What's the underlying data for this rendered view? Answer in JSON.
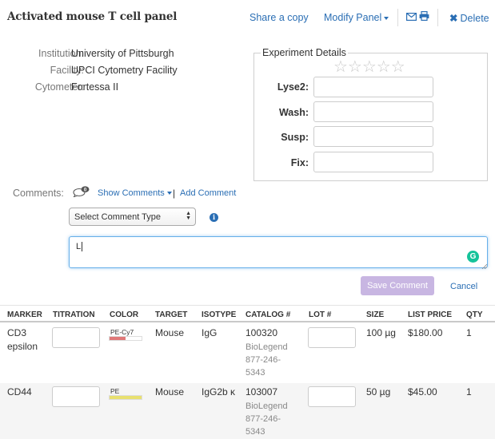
{
  "header": {
    "title": "Activated mouse T cell panel",
    "share_label": "Share a copy",
    "modify_label": "Modify Panel",
    "delete_label": "Delete"
  },
  "info": {
    "institution_label": "Institution:",
    "institution_value": "University of Pittsburgh",
    "facility_label": "Facility:",
    "facility_value": "UPCI Cytometry Facility",
    "cytometer_label": "Cytometer:",
    "cytometer_value": "Fortessa II"
  },
  "experiment": {
    "legend": "Experiment Details",
    "stars": "☆☆☆☆☆",
    "rating": 0,
    "rating_max": 5,
    "fields": [
      {
        "label": "Lyse2:",
        "value": ""
      },
      {
        "label": "Wash:",
        "value": ""
      },
      {
        "label": "Susp:",
        "value": ""
      },
      {
        "label": "Fix:",
        "value": ""
      }
    ]
  },
  "comments": {
    "label": "Comments:",
    "count": "0",
    "show_label": "Show Comments",
    "separator": "|",
    "add_label": "Add Comment",
    "type_select": "Select Comment Type",
    "text_value": "L",
    "save_label": "Save Comment",
    "cancel_label": "Cancel"
  },
  "table": {
    "columns": [
      "MARKER",
      "TITRATION",
      "COLOR",
      "TARGET",
      "ISOTYPE",
      "CATALOG #",
      "LOT #",
      "SIZE",
      "LIST PRICE",
      "QTY"
    ],
    "rows": [
      {
        "marker": "CD3 epsilon",
        "titration": "",
        "color": "PE-Cy7",
        "color_swatch": [
          "#e07878",
          "#e07878",
          "#ffffff",
          "#ffffff"
        ],
        "target": "Mouse",
        "isotype": "IgG",
        "catalog": "100320",
        "vendor": "BioLegend",
        "phone": "877-246-5343",
        "lot": "",
        "size": "100 µg",
        "price": "$180.00",
        "qty": "1"
      },
      {
        "marker": "CD44",
        "titration": "",
        "color": "PE",
        "color_swatch": [
          "#e8e070",
          "#e8e070",
          "#e8e070",
          "#e8e070"
        ],
        "target": "Mouse",
        "isotype": "IgG2b κ",
        "catalog": "103007",
        "vendor": "BioLegend",
        "phone": "877-246-5343",
        "lot": "",
        "size": "50 µg",
        "price": "$45.00",
        "qty": "1"
      }
    ]
  },
  "colors": {
    "link": "#2a6eb4",
    "save_button": "#c8b6e2",
    "focus_border": "#66afe9",
    "grammarly": "#15c39a"
  },
  "icons": [
    "envelope-icon",
    "printer-icon",
    "close-icon",
    "comment-bubble-icon",
    "info-icon",
    "star-icon",
    "grammarly-icon"
  ]
}
